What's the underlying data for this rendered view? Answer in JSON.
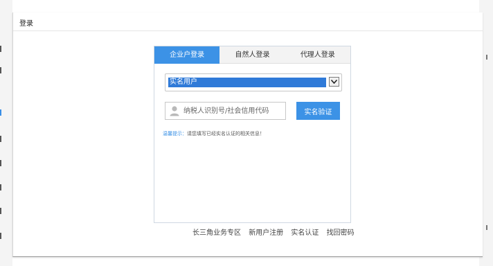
{
  "dialog": {
    "title": "登录"
  },
  "tabs": [
    {
      "label": "企业户登录",
      "active": true
    },
    {
      "label": "自然人登录",
      "active": false
    },
    {
      "label": "代理人登录",
      "active": false
    }
  ],
  "form": {
    "user_type_selected": "实名用户",
    "id_placeholder": "纳税人识别号/社会信用代码",
    "verify_button": "实名验证",
    "hint_label": "温馨提示：",
    "hint_text": "请您填写已经实名认证的相关信息！"
  },
  "footer_links": [
    "长三角业务专区",
    "新用户注册",
    "实名认证",
    "找回密码"
  ],
  "colors": {
    "accent": "#3c92e6",
    "select_highlight": "#2f7ad8"
  },
  "icons": {
    "user": "user-icon",
    "dropdown": "chevron-down-icon"
  }
}
